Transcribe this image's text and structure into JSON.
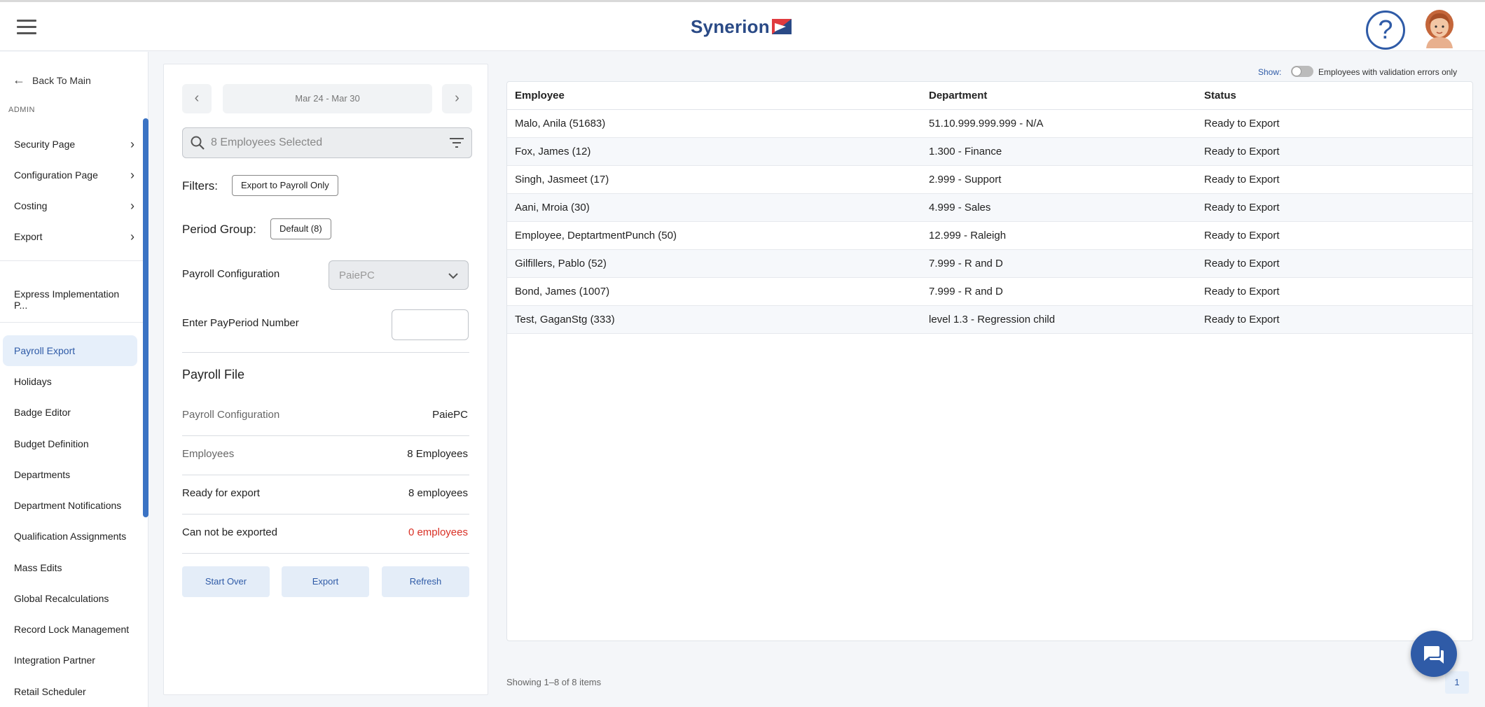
{
  "header": {
    "logo_text": "Synerion",
    "help_label": "?",
    "brand_color": "#2a4a86"
  },
  "sidebar": {
    "back_label": "Back To Main",
    "section_label": "ADMIN",
    "group_items": [
      {
        "label": "Security Page"
      },
      {
        "label": "Configuration Page"
      },
      {
        "label": "Costing"
      },
      {
        "label": "Export"
      }
    ],
    "express_label": "Express Implementation P...",
    "items": [
      {
        "label": "Payroll Export",
        "active": true
      },
      {
        "label": "Holidays"
      },
      {
        "label": "Badge Editor"
      },
      {
        "label": "Budget Definition"
      },
      {
        "label": "Departments"
      },
      {
        "label": "Department Notifications"
      },
      {
        "label": "Qualification Assignments"
      },
      {
        "label": "Mass Edits"
      },
      {
        "label": "Global Recalculations"
      },
      {
        "label": "Record Lock Management"
      },
      {
        "label": "Integration Partner"
      },
      {
        "label": "Retail Scheduler"
      }
    ]
  },
  "panel": {
    "date_range": "Mar 24 - Mar 30",
    "prev_label": "‹",
    "next_label": "›",
    "search_placeholder": "8 Employees Selected",
    "filters_label": "Filters:",
    "filter_chip": "Export to Payroll Only",
    "period_group_label": "Period Group:",
    "period_group_chip": "Default (8)",
    "payroll_config_label": "Payroll Configuration",
    "payroll_config_value": "PaiePC",
    "pay_period_label": "Enter PayPeriod Number",
    "pay_period_value": "",
    "payroll_file_title": "Payroll File",
    "summary": [
      {
        "key": "Payroll Configuration",
        "value": "PaiePC"
      },
      {
        "key": "Employees",
        "value": "8 Employees"
      },
      {
        "key": "Ready for export",
        "value": "8 employees"
      },
      {
        "key": "Can not be exported",
        "value": "0 employees"
      }
    ],
    "error_color": "#d93025",
    "buttons": {
      "start_over": "Start Over",
      "export": "Export",
      "refresh": "Refresh"
    }
  },
  "grid": {
    "show_label": "Show:",
    "show_toggle_text": "Employees with validation errors only",
    "columns": [
      "Employee",
      "Department",
      "Status"
    ],
    "rows": [
      {
        "employee": "Malo, Anila (51683)",
        "department": "51.10.999.999.999 - N/A",
        "status": "Ready to Export"
      },
      {
        "employee": "Fox, James (12)",
        "department": "1.300 - Finance",
        "status": "Ready to Export"
      },
      {
        "employee": "Singh, Jasmeet (17)",
        "department": "2.999 - Support",
        "status": "Ready to Export"
      },
      {
        "employee": "Aani, Mroia (30)",
        "department": "4.999 - Sales",
        "status": "Ready to Export"
      },
      {
        "employee": "Employee, DeptartmentPunch (50)",
        "department": "12.999 - Raleigh",
        "status": "Ready to Export"
      },
      {
        "employee": "Gilfillers, Pablo (52)",
        "department": "7.999 - R and D",
        "status": "Ready to Export"
      },
      {
        "employee": "Bond, James (1007)",
        "department": "7.999 - R and D",
        "status": "Ready to Export"
      },
      {
        "employee": "Test, GaganStg (333)",
        "department": "level 1.3 - Regression child",
        "status": "Ready to Export"
      }
    ],
    "footer_text": "Showing 1–8 of 8 items",
    "page": "1"
  },
  "accent_color": "#2f5ba7"
}
